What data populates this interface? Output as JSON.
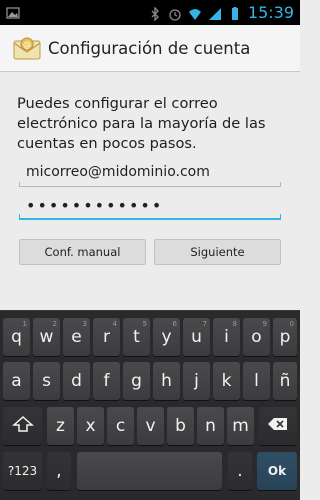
{
  "status_bar": {
    "time": "15:39",
    "icons": [
      "image-notification-icon",
      "bluetooth-icon",
      "alarm-icon",
      "wifi-icon",
      "signal-icon",
      "battery-icon"
    ]
  },
  "action_bar": {
    "title": "Configuración de cuenta",
    "app_icon": "email-envelope-icon"
  },
  "form": {
    "intro": "Puedes configurar el correo electrónico para la mayoría de las cuentas en pocos pasos.",
    "email_value": "micorreo@midominio.com",
    "password_value": "••••••••••••"
  },
  "buttons": {
    "manual": "Conf. manual",
    "next": "Siguiente"
  },
  "keyboard": {
    "row1": [
      {
        "k": "q",
        "sub": "1"
      },
      {
        "k": "w",
        "sub": "2"
      },
      {
        "k": "e",
        "sub": "3"
      },
      {
        "k": "r",
        "sub": "4"
      },
      {
        "k": "t",
        "sub": "5"
      },
      {
        "k": "y",
        "sub": "6"
      },
      {
        "k": "u",
        "sub": "7"
      },
      {
        "k": "i",
        "sub": "8"
      },
      {
        "k": "o",
        "sub": "9"
      },
      {
        "k": "p",
        "sub": "0"
      }
    ],
    "row2": [
      "a",
      "s",
      "d",
      "f",
      "g",
      "h",
      "j",
      "k",
      "l",
      "ñ"
    ],
    "row3": [
      "z",
      "x",
      "c",
      "v",
      "b",
      "n",
      "m"
    ],
    "symbols_label": "?123",
    "comma": ",",
    "comma_sub": "",
    "period": ".",
    "ok_label": "Ok",
    "colors": {
      "accent": "#33b5e5",
      "key": "#444446",
      "keyboard_bg": "#2a2a2c"
    }
  }
}
